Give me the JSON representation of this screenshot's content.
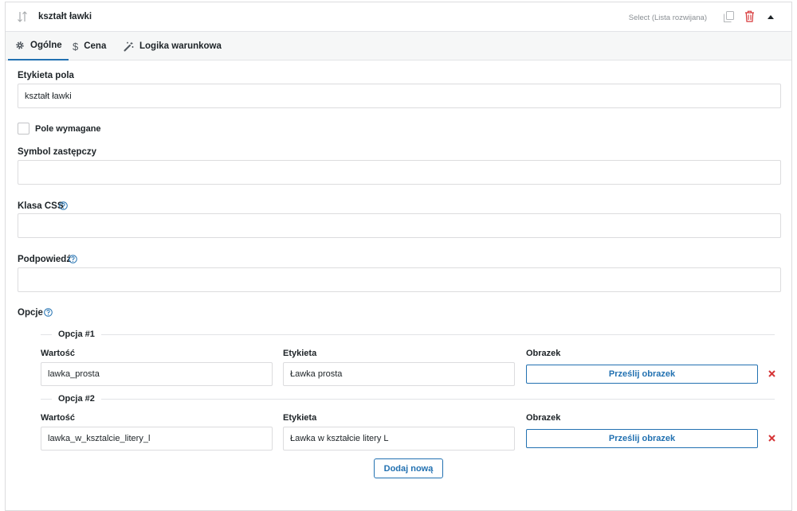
{
  "header": {
    "title": "kształt ławki",
    "field_type": "Select (Lista rozwijana)"
  },
  "tabs": [
    {
      "label": "Ogólne",
      "icon": "gear-icon",
      "active": true
    },
    {
      "label": "Cena",
      "icon": "dollar-icon",
      "active": false
    },
    {
      "label": "Logika warunkowa",
      "icon": "magic-wand-icon",
      "active": false
    }
  ],
  "form": {
    "field_label": {
      "label": "Etykieta pola",
      "value": "kształt ławki"
    },
    "required": {
      "label": "Pole wymagane",
      "checked": false
    },
    "placeholder": {
      "label": "Symbol zastępczy",
      "value": ""
    },
    "css_class": {
      "label": "Klasa CSS",
      "value": ""
    },
    "hint": {
      "label": "Podpowiedź",
      "value": ""
    },
    "options_label": "Opcje"
  },
  "options": [
    {
      "legend": "Opcja #1",
      "value_label": "Wartość",
      "value": "lawka_prosta",
      "label_label": "Etykieta",
      "label": "Ławka prosta",
      "image_label": "Obrazek",
      "upload_label": "Prześlij obrazek"
    },
    {
      "legend": "Opcja #2",
      "value_label": "Wartość",
      "value": "lawka_w_ksztalcie_litery_l",
      "label_label": "Etykieta",
      "label": "Ławka w kształcie litery L",
      "image_label": "Obrazek",
      "upload_label": "Prześlij obrazek"
    }
  ],
  "add_new_label": "Dodaj nową",
  "colors": {
    "accent": "#2271b1",
    "delete": "#d63638",
    "border": "#dcdcde"
  }
}
